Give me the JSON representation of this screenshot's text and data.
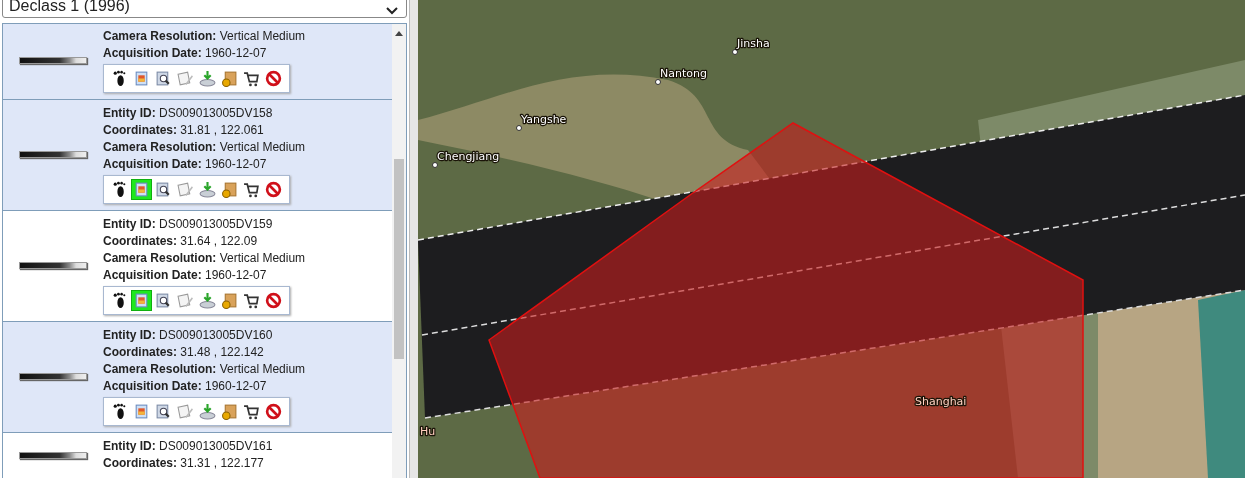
{
  "dataset_select": {
    "value": "Declass 1 (1996)"
  },
  "records": [
    {
      "highlighted": true,
      "browse_on": false,
      "fields": [
        {
          "label": "Camera Resolution:",
          "value": "Vertical Medium"
        },
        {
          "label": "Acquisition Date:",
          "value": "1960-12-07"
        }
      ]
    },
    {
      "highlighted": true,
      "browse_on": true,
      "fields": [
        {
          "label": "Entity ID:",
          "value": "DS009013005DV158"
        },
        {
          "label": "Coordinates:",
          "value": "31.81 , 122.061"
        },
        {
          "label": "Camera Resolution:",
          "value": "Vertical Medium"
        },
        {
          "label": "Acquisition Date:",
          "value": "1960-12-07"
        }
      ]
    },
    {
      "highlighted": false,
      "browse_on": true,
      "fields": [
        {
          "label": "Entity ID:",
          "value": "DS009013005DV159"
        },
        {
          "label": "Coordinates:",
          "value": "31.64 , 122.09"
        },
        {
          "label": "Camera Resolution:",
          "value": "Vertical Medium"
        },
        {
          "label": "Acquisition Date:",
          "value": "1960-12-07"
        }
      ]
    },
    {
      "highlighted": true,
      "browse_on": false,
      "fields": [
        {
          "label": "Entity ID:",
          "value": "DS009013005DV160"
        },
        {
          "label": "Coordinates:",
          "value": "31.48 , 122.142"
        },
        {
          "label": "Camera Resolution:",
          "value": "Vertical Medium"
        },
        {
          "label": "Acquisition Date:",
          "value": "1960-12-07"
        }
      ]
    },
    {
      "highlighted": false,
      "fields": [
        {
          "label": "Entity ID:",
          "value": "DS009013005DV161"
        },
        {
          "label": "Coordinates:",
          "value": "31.31 , 122.177"
        }
      ]
    }
  ],
  "map": {
    "labels": [
      {
        "text": "Jinsha",
        "kind": "city"
      },
      {
        "text": "Nantong",
        "kind": "city"
      },
      {
        "text": "Yangshe",
        "kind": "city"
      },
      {
        "text": "Chengjiang",
        "kind": "city"
      },
      {
        "text": "Shanghai",
        "kind": "region"
      },
      {
        "text": "Hu",
        "kind": "region"
      }
    ]
  }
}
